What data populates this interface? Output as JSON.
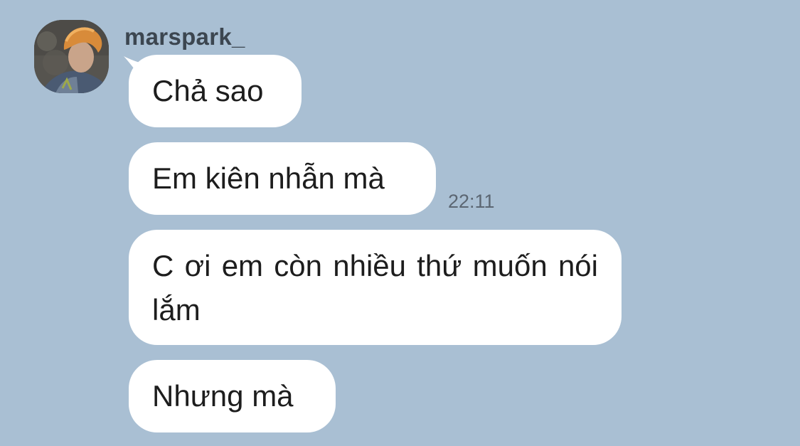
{
  "sender": {
    "name": "marspark_"
  },
  "messages": [
    {
      "text": "Chả sao"
    },
    {
      "text": "Em kiên nhẫn mà",
      "time": "22:11"
    },
    {
      "text": "C ơi em còn nhiều thứ muốn nói lắm"
    },
    {
      "text": "Nhưng mà"
    }
  ],
  "colors": {
    "background": "#a9bfd3",
    "bubble": "#ffffff",
    "text": "#1d1d1d",
    "name": "#3c4650",
    "timestamp": "#5b6672"
  },
  "icons": {
    "avatar": "user-avatar-photo"
  }
}
